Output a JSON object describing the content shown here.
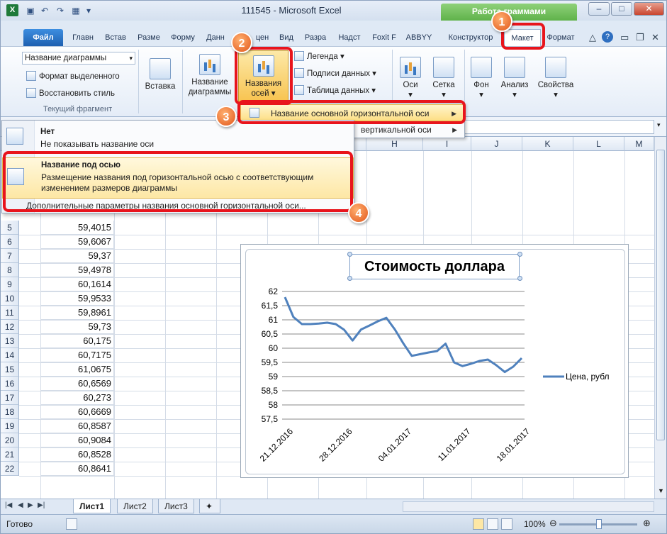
{
  "window": {
    "title": "111545 - Microsoft Excel",
    "app_icon_glyph": "X",
    "chart_tools_label": "Работа с диаграммами",
    "chart_tools_visible": "Работа             граммами",
    "min": "–",
    "max": "□",
    "close": "✕"
  },
  "tabs": [
    "Файл",
    "Главн",
    "Встав",
    "Разме",
    "Форму",
    "Данн",
    "цен",
    "Вид",
    "Разра",
    "Надст",
    "Foxit F",
    "ABBYY",
    "Конструктор",
    "Макет",
    "Формат"
  ],
  "ribbon": {
    "current_selection": {
      "combo_value": "Название диаграммы",
      "format_selection": "Формат выделенного",
      "reset_style": "Восстановить стиль",
      "group_label": "Текущий фрагмент"
    },
    "insert": "Вставка",
    "chart_title_1": "Название",
    "chart_title_2": "диаграммы",
    "axis_titles_1": "Названия",
    "axis_titles_2": "осей",
    "legend": "Легенда",
    "data_labels": "Подписи данных",
    "data_table": "Таблица данных",
    "axes": "Оси",
    "gridlines": "Сетка",
    "plot_area": "Фон",
    "analysis": "Анализ",
    "properties": "Свойства"
  },
  "submenu": {
    "primary_horizontal": "Название основной горизонтальной оси",
    "primary_vertical": "вертикальной оси"
  },
  "menu": {
    "none_title": "Нет",
    "none_desc": "Не показывать название оси",
    "below_title": "Название под осью",
    "below_desc": "Размещение названия под горизонтальной осью с соответствующим изменением размеров диаграммы",
    "more": "Дополнительные параметры названия основной горизонтальной оси..."
  },
  "badges": [
    "1",
    "2",
    "3",
    "4"
  ],
  "grid": {
    "columns": [
      "H",
      "I",
      "J",
      "K",
      "L",
      "M"
    ],
    "rows": [
      {
        "n": "5",
        "v": "59,4015"
      },
      {
        "n": "6",
        "v": "59,6067"
      },
      {
        "n": "7",
        "v": "59,37"
      },
      {
        "n": "8",
        "v": "59,4978"
      },
      {
        "n": "9",
        "v": "60,1614"
      },
      {
        "n": "10",
        "v": "59,9533"
      },
      {
        "n": "11",
        "v": "59,8961"
      },
      {
        "n": "12",
        "v": "59,73"
      },
      {
        "n": "13",
        "v": "60,175"
      },
      {
        "n": "14",
        "v": "60,7175"
      },
      {
        "n": "15",
        "v": "61,0675"
      },
      {
        "n": "16",
        "v": "60,6569"
      },
      {
        "n": "17",
        "v": "60,273"
      },
      {
        "n": "18",
        "v": "60,6669"
      },
      {
        "n": "19",
        "v": "60,8587"
      },
      {
        "n": "20",
        "v": "60,9084"
      },
      {
        "n": "21",
        "v": "60,8528"
      },
      {
        "n": "22",
        "v": "60,8641"
      }
    ]
  },
  "chart_data": {
    "type": "line",
    "title": "Стоимость доллара",
    "xlabel": "",
    "ylabel": "",
    "ylim": [
      57.5,
      62
    ],
    "yticks": [
      "62",
      "61,5",
      "61",
      "60,5",
      "60",
      "59,5",
      "59",
      "58,5",
      "58",
      "57,5"
    ],
    "xticks": [
      "21.12.2016",
      "28.12.2016",
      "04.01.2017",
      "11.01.2017",
      "18.01.2017"
    ],
    "legend_position": "right",
    "series": [
      {
        "name": "Цена, рубл",
        "color": "#4f81bd",
        "values": [
          61.8,
          61.1,
          60.85,
          60.85,
          60.87,
          60.9,
          60.85,
          60.65,
          60.27,
          60.66,
          60.8,
          60.95,
          61.07,
          60.66,
          60.17,
          59.73,
          59.79,
          59.85,
          59.9,
          60.16,
          59.5,
          59.37,
          59.45,
          59.55,
          59.6,
          59.4,
          59.16,
          59.35,
          59.65
        ]
      }
    ]
  },
  "sheets": [
    "Лист1",
    "Лист2",
    "Лист3"
  ],
  "status": {
    "ready": "Готово",
    "zoom": "100%",
    "zoom_value": 100
  }
}
